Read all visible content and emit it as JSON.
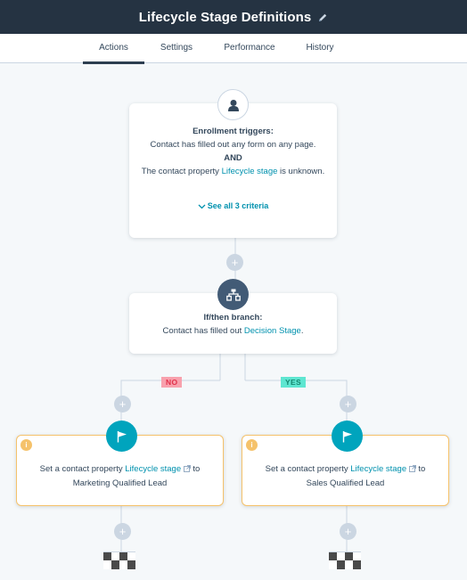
{
  "header": {
    "title": "Lifecycle Stage Definitions",
    "edit_icon": "pencil-icon"
  },
  "tabs": [
    {
      "label": "Actions",
      "active": true
    },
    {
      "label": "Settings",
      "active": false
    },
    {
      "label": "Performance",
      "active": false
    },
    {
      "label": "History",
      "active": false
    }
  ],
  "trigger": {
    "icon": "contact-icon",
    "title": "Enrollment triggers:",
    "line1": "Contact has filled out any form on any page.",
    "operator": "AND",
    "line2_prefix": "The contact property ",
    "line2_link": "Lifecycle stage",
    "line2_suffix": " is unknown.",
    "see_all": "See all 3 criteria",
    "see_all_icon": "chevron-down-icon"
  },
  "add_action_symbol": "+",
  "branch": {
    "icon": "branch-icon",
    "title": "If/then branch:",
    "text_prefix": "Contact has filled out ",
    "text_link": "Decision Stage",
    "text_suffix": "."
  },
  "branches": {
    "no_label": "NO",
    "yes_label": "YES"
  },
  "actions": [
    {
      "icon": "flag-icon",
      "info_icon": "info-icon",
      "text_prefix": "Set a contact property ",
      "link": "Lifecycle stage",
      "link_icon": "external-link-icon",
      "text_suffix": " to",
      "value": "Marketing Qualified Lead"
    },
    {
      "icon": "flag-icon",
      "info_icon": "info-icon",
      "text_prefix": "Set a contact property ",
      "link": "Lifecycle stage",
      "link_icon": "external-link-icon",
      "text_suffix": " to",
      "value": "Sales Qualified Lead"
    }
  ],
  "info_glyph": "i",
  "colors": {
    "header_bg": "#253342",
    "background": "#f5f8fa",
    "link": "#0091ae",
    "connector": "#cbd6e2",
    "action_accent": "#f5c26b",
    "flag_circle": "#00a4bd",
    "branch_circle": "#425b76",
    "no_badge": "#f8a1ad",
    "yes_badge": "#5ee6d1"
  }
}
